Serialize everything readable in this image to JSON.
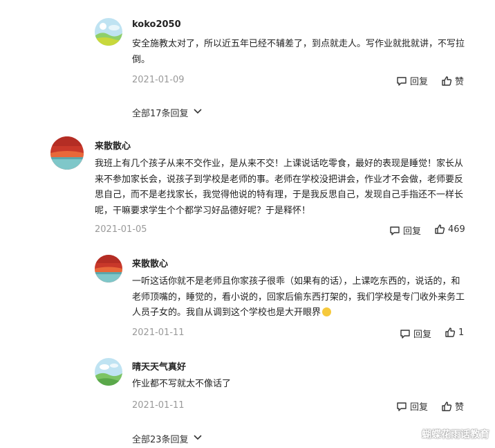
{
  "comments": [
    {
      "author": "koko2050",
      "text": "安全施教太对了，所以近五年已经不辅差了，到点就走人。写作业就批就讲，不写拉倒。",
      "date": "2021-01-09",
      "reply_label": "回复",
      "like_label": "赞",
      "expand_label": "全部17条回复"
    },
    {
      "author": "来散散心",
      "text": "我班上有几个孩子从来不交作业，是从来不交！上课说话吃零食，最好的表现是睡觉！家长从来不参加家长会，说孩子到学校是老师的事。老师在学校没把讲会，作业才不会做，老师要反思自己，而不是老找家长，我觉得他说的特有理，于是我反思自己，发现自己手指还不一样长呢，干嘛要求学生个个都学习好品德好呢？于是释怀！",
      "date": "2021-01-05",
      "reply_label": "回复",
      "like_label": "469"
    },
    {
      "author": "来散散心",
      "text": "一听这话你就不是老师且你家孩子很乖（如果有的话），上课吃东西的，说话的，和老师顶嘴的，睡觉的，看小说的，回家后偷东西打架的，我们学校是专门收外来务工人员子女的。我自从调到这个学校也是大开眼界",
      "date": "2021-01-11",
      "reply_label": "回复",
      "like_label": "1"
    },
    {
      "author": "晴天天气真好",
      "text": "作业都不写就太不像话了",
      "date": "2021-01-11",
      "reply_label": "回复",
      "like_label": "赞",
      "expand_label": "全部23条回复"
    }
  ],
  "watermark": "蝴蝶花雨话教育",
  "icons": {
    "reply": "comment-bubble-icon",
    "like": "thumbs-up-icon",
    "expand": "chevron-down-icon",
    "emoji": "dizzy-face-emoji"
  }
}
